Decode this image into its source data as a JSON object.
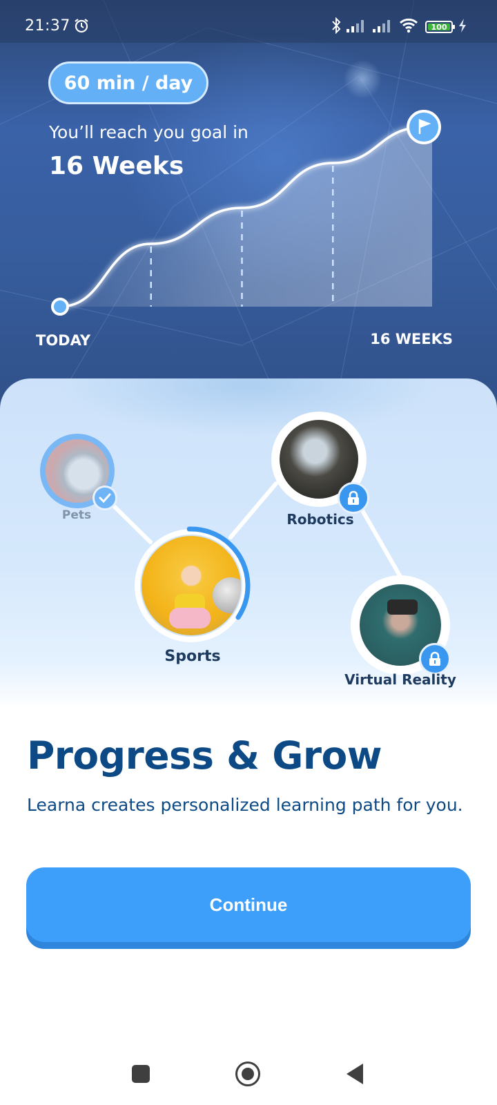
{
  "status_bar": {
    "time": "21:37",
    "icons": [
      "alarm-icon",
      "bluetooth-icon",
      "signal-icon",
      "signal-icon",
      "wifi-icon",
      "battery-icon",
      "charging-icon"
    ],
    "battery_level": "100"
  },
  "hero": {
    "goal_pill": "60 min / day",
    "caption": "You’ll reach you goal in",
    "goal_value": "16 Weeks"
  },
  "chart_data": {
    "type": "line",
    "title": "You’ll reach you goal in 16 Weeks",
    "x_labels": [
      "TODAY",
      "16 WEEKS"
    ],
    "x": [
      0,
      4,
      8,
      12,
      16
    ],
    "series": [
      {
        "name": "progress",
        "values": [
          0,
          35,
          55,
          80,
          100
        ]
      }
    ],
    "xlim": [
      0,
      16
    ],
    "ylim": [
      0,
      100
    ],
    "markers": {
      "start": "dot",
      "end": "flag-icon"
    },
    "dashed_guides_at_x": [
      4,
      8,
      12
    ],
    "grid": false
  },
  "learning_path": {
    "nodes": [
      {
        "label": "Pets",
        "state": "completed",
        "badge_icon": "check-icon",
        "image": "dog-photo"
      },
      {
        "label": "Sports",
        "state": "in-progress",
        "progress": 0.35,
        "image": "fitness-woman-photo"
      },
      {
        "label": "Robotics",
        "state": "locked",
        "badge_icon": "lock-icon",
        "image": "robot-hand-photo"
      },
      {
        "label": "Virtual Reality",
        "state": "locked",
        "badge_icon": "lock-icon",
        "image": "vr-headset-photo"
      }
    ]
  },
  "content": {
    "title": "Progress & Grow",
    "subtitle": "Learna creates personalized learning path for you.",
    "continue_label": "Continue"
  },
  "colors": {
    "accent": "#3e9ffb",
    "title": "#0d4a85",
    "hero_bg": "#3a62a8",
    "pill": "#63b0f7",
    "battery": "#3db43a"
  },
  "nav_bar": {
    "buttons": [
      "recents-icon",
      "home-icon",
      "back-icon"
    ]
  }
}
